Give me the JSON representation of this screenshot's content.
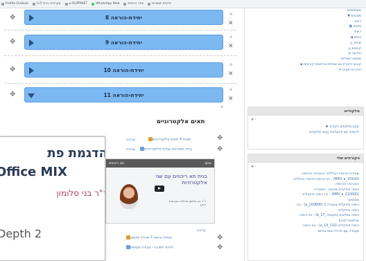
{
  "bookmarks": [
    {
      "icon": "page-icon",
      "label": "Profile Outlook"
    },
    {
      "icon": "page-icon",
      "label": "מערכות ניהול 5.0"
    },
    {
      "icon": "page-icon",
      "label": "ש.RUPPINET"
    },
    {
      "icon": "whatsapp-icon",
      "label": "WhatsApp Web"
    },
    {
      "icon": "page-icon",
      "label": "אתר הכנסת"
    },
    {
      "icon": "page-icon",
      "label": "פרטים חשובים"
    }
  ],
  "units": [
    {
      "label": "יחידת-הוראה 8",
      "state": "collapsed"
    },
    {
      "label": "יחידת-הוראה 9",
      "state": "collapsed"
    },
    {
      "label": "יחידת-הוראה 10",
      "state": "collapsed"
    },
    {
      "label": "יחידת-הוראה 11",
      "state": "expanded"
    }
  ],
  "section": {
    "title": "תאים אלקטרוניים",
    "activities": [
      {
        "label": "מצגת 4 תאים אלקטרוניים",
        "edit": "עריכה"
      },
      {
        "label": "בנייה מפורטת ועלות אלקטרוניים",
        "edit": "עריכה"
      }
    ],
    "video": {
      "bar_title": "תא ריכוזים",
      "bar_right": "שתף",
      "title": "בנית תא ריכוזים עם שני אלקטרודות",
      "credits": "ד\"ר בני סלומון מכללה אקדמית רופין"
    },
    "edit_after_video": "עריכה",
    "more_activities": [
      {
        "label": "מטלה ביתית 7 תרגיל וחישוב"
      },
      {
        "label": "חידות חשיבה - עבודה מעשית"
      }
    ]
  },
  "slide": {
    "line1": "הדגמת פת",
    "line2": "Office MIX",
    "line3": "ד\"ר בני סלומון",
    "line4": "Depth 2"
  },
  "sidebar": {
    "tree": [
      "משתתפים",
      "מסננים ▼",
      "דיווח",
      "ציונים ▦",
      "דיווחי",
      "בטים ▪",
      "שיחה ◬",
      "קבצים ◬",
      "הודעה ◎",
      "משאבי שאלות",
      "קבועי הקורס גם שאלות מרחבות קורסות ▪",
      "הגדרות מערך ▾"
    ],
    "search_block": {
      "title": "מלקחיים",
      "tools": "✥ -",
      "lines": [
        "קבע מלקחים הקורס ♣",
        "להוסיף זמן להעלאת קבצי מלקחים"
      ]
    },
    "recent_block": {
      "title": "הקורסים שלי",
      "tools": "✥ -",
      "lines": [
        "שמירת הכימיה הכללית, האנרגיה והכימיה",
        "(MPO_a_10100) - כח ברנות הכימיה הכללית,",
        "האנרגיה והכימיה",
        "כימיה פיזיקלית מדעית - תיאוריה",
        "(MPP_a_210000) - כח כימיה פיזיקלית -",
        "מבחנים",
        "כימיה פיזיקלית מעבדה 1 (100800_a) - כח",
        "כימיה פיזיקלית",
        "כימיה אנליטית (תעשייה_b_17) - כח כימיה",
        "אנליטית לבנים",
        "כימיה פיזיקלית (132_a_10) - כח כימיה",
        "מעבדה עם תרגיל ונומי בחינם"
      ]
    }
  }
}
